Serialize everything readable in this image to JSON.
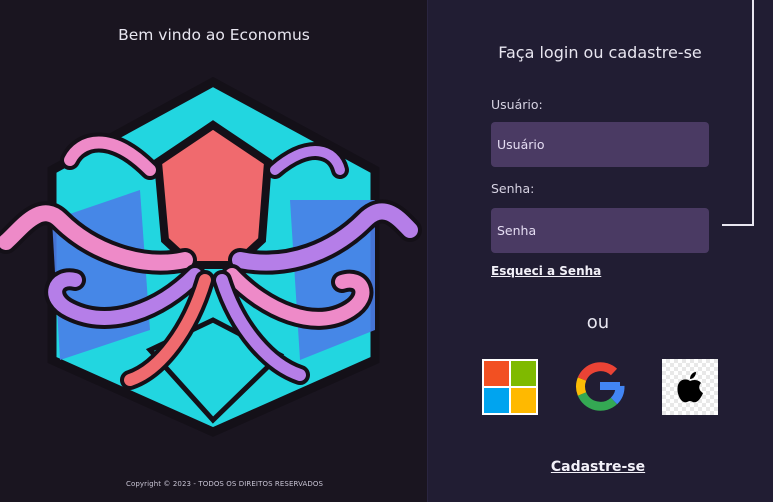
{
  "left_panel": {
    "welcome": "Bem vindo ao Economus",
    "copyright": "Copyright © 2023 - TODOS OS DIREITOS RESERVADOS"
  },
  "login": {
    "title": "Faça login ou cadastre-se",
    "username_label": "Usuário:",
    "username_placeholder": "Usuário",
    "password_label": "Senha:",
    "password_placeholder": "Senha",
    "forgot_password": "Esqueci a Senha",
    "or": "ou",
    "signup": "Cadastre-se"
  },
  "social_logins": [
    {
      "name": "microsoft",
      "icon": "microsoft-icon"
    },
    {
      "name": "google",
      "icon": "google-icon"
    },
    {
      "name": "apple",
      "icon": "apple-icon"
    }
  ],
  "colors": {
    "left_bg": "#1a1520",
    "right_bg": "#211d33",
    "input_bg": "#4a3a63",
    "logo_cyan": "#22d6e0",
    "logo_blue": "#4a7ee8",
    "logo_coral": "#f06a6e",
    "logo_purple": "#b57ee8",
    "logo_pink": "#ee8ac8"
  }
}
